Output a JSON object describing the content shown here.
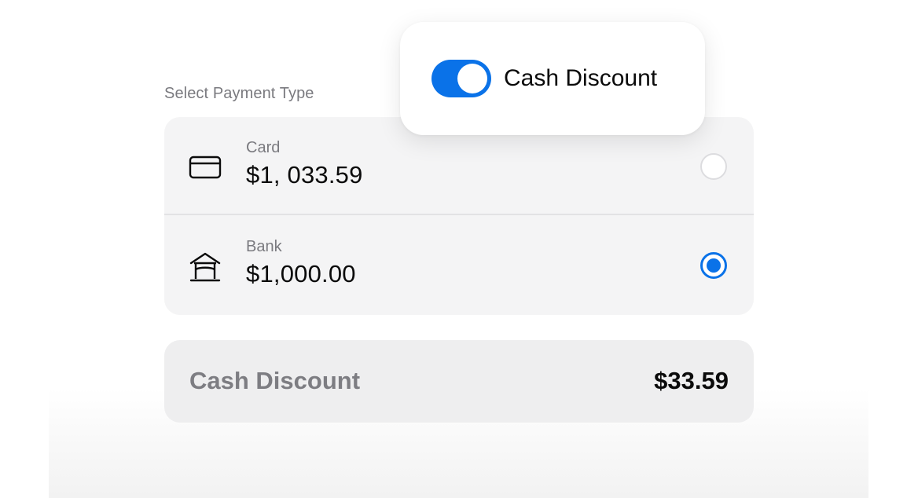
{
  "payment": {
    "section_label": "Select Payment Type",
    "options": [
      {
        "label": "Card",
        "amount": "$1, 033.59",
        "icon": "credit-card-icon",
        "selected": false
      },
      {
        "label": "Bank",
        "amount": "$1,000.00",
        "icon": "bank-icon",
        "selected": true
      }
    ]
  },
  "discount": {
    "label": "Cash Discount",
    "value": "$33.59"
  },
  "toggle": {
    "label": "Cash Discount",
    "on": true
  },
  "colors": {
    "accent": "#0a72e8",
    "muted_text": "#7a7a7f",
    "card_background": "#f4f4f5"
  }
}
